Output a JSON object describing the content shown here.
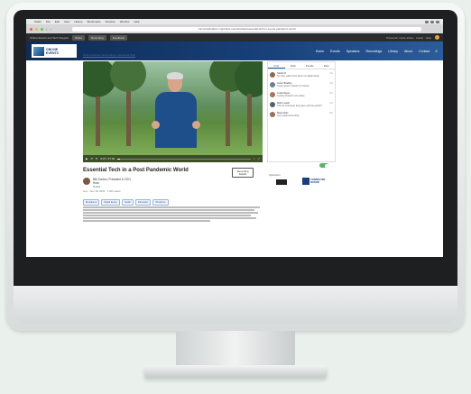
{
  "browser": {
    "menu_items": [
      "Safari",
      "File",
      "Edit",
      "View",
      "History",
      "Bookmarks",
      "Develop",
      "Window",
      "Help"
    ],
    "address": "connectednation.org/online-events/video/essential-tech-in-a-post-pandemic-world",
    "bar_label": "Online Events and Tech Support",
    "pills": [
      "Share",
      "Recording",
      "Feedback"
    ],
    "bar_message": "Presenter mode active · Leave · Help"
  },
  "site": {
    "logo_line1": "ONLINE",
    "logo_line2": "EVENTS",
    "nav": [
      "Home",
      "Events",
      "Speakers",
      "Recordings",
      "Library",
      "About",
      "Contact"
    ]
  },
  "breadcrumb": "Online Events / Recordings / Essential Tech",
  "video": {
    "time": "0:47 / 47:04",
    "progress": 0.02
  },
  "main": {
    "title": "Essential Tech in a Post Pandemic World",
    "record_button": "Recording Details",
    "author_name": "Bill Gordon, President & CEO",
    "author_role": "Host",
    "author_status": "Online",
    "meta": "Live · Nov 18, 2020 · 1,204 views"
  },
  "tags": [
    "Broadband",
    "Digital Equity",
    "Health",
    "Education",
    "Workforce"
  ],
  "panel": {
    "tabs": [
      "Chat",
      "Q&A",
      "People",
      "Files"
    ],
    "comments": [
      {
        "name": "Sarah M.",
        "time": "2m",
        "text": "So many valid points about our digital divide.",
        "color": "#8a6a55"
      },
      {
        "name": "Jason Bradley",
        "time": "3m",
        "text": "Great session, thanks for hosting!",
        "color": "#6d7f93"
      },
      {
        "name": "Linda Reyes",
        "time": "5m",
        "text": "Looking forward to the slides.",
        "color": "#b0705a"
      },
      {
        "name": "Mark Lowell",
        "time": "6m",
        "text": "How do rural areas keep pace with the growth?",
        "color": "#556070"
      },
      {
        "name": "Maria Diaz",
        "time": "8m",
        "text": "Very helpful information.",
        "color": "#9a6e5c"
      }
    ]
  },
  "sponsors": {
    "label": "Sponsors",
    "second_line1": "CONNECTED",
    "second_line2": "NATION"
  }
}
